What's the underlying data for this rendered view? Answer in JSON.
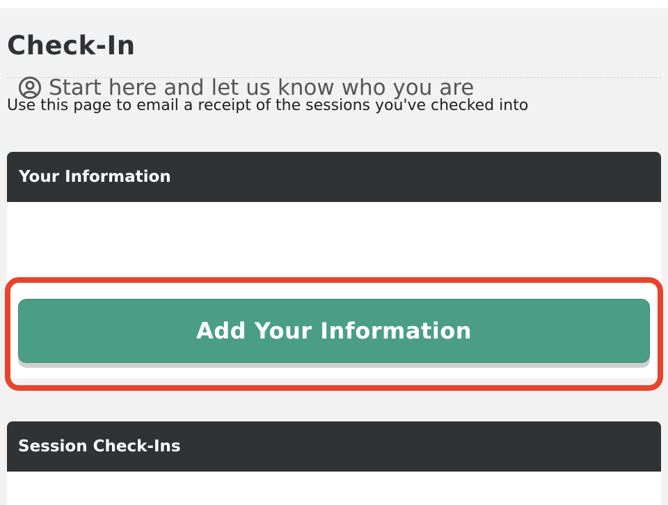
{
  "page": {
    "title": "Check-In",
    "intro": "Use this page to email a receipt of the sessions you've checked into"
  },
  "your_information": {
    "header": "Your Information",
    "prompt_icon": "user-circle-icon",
    "prompt": "Start here and let us know who you are",
    "button_label": "Add Your Information"
  },
  "session_checkins": {
    "header": "Session Check-Ins"
  },
  "colors": {
    "background": "#f2f2f2",
    "card_header": "#2f3336",
    "button": "#4a9e86",
    "highlight": "#e8432b"
  }
}
